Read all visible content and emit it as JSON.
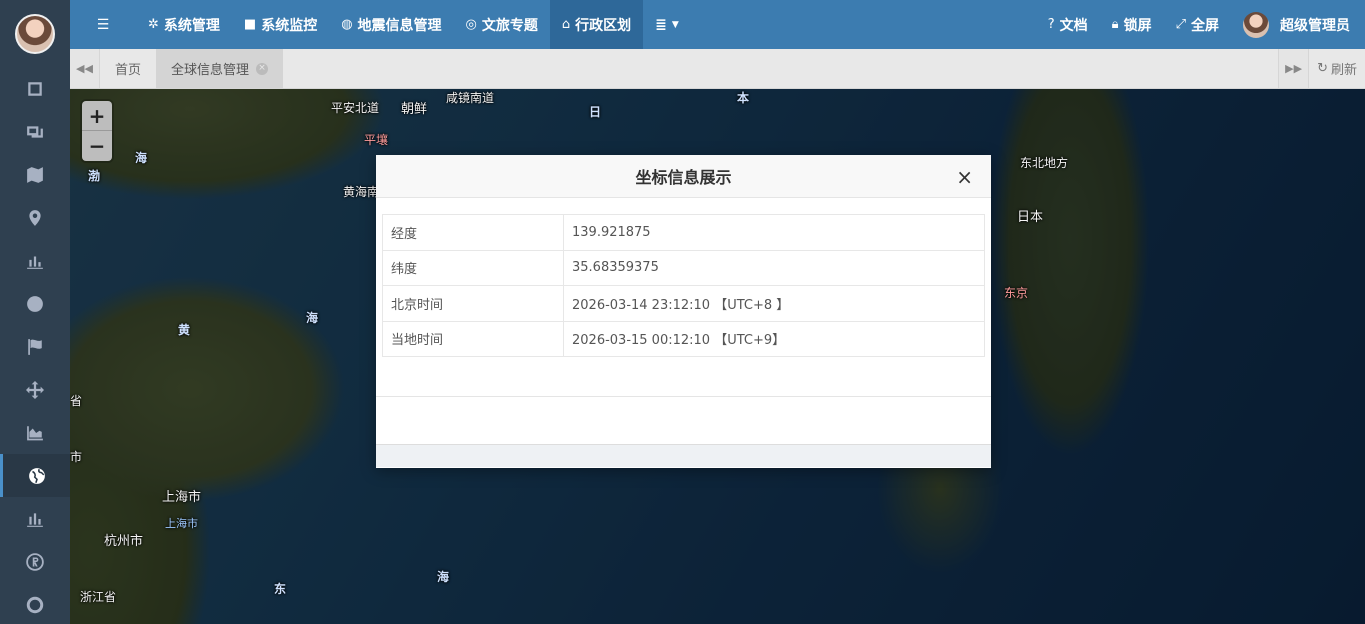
{
  "sidebar": {
    "items": [
      {
        "icon": "frame-icon"
      },
      {
        "icon": "frames-icon"
      },
      {
        "icon": "map-icon"
      },
      {
        "icon": "map-marker-icon"
      },
      {
        "icon": "bar-chart-icon"
      },
      {
        "icon": "globe-icon"
      },
      {
        "icon": "flag-icon"
      },
      {
        "icon": "move-arrows-icon"
      },
      {
        "icon": "area-chart-icon"
      },
      {
        "icon": "globe-icon",
        "active": true
      },
      {
        "icon": "bar-chart-icon"
      },
      {
        "icon": "registered-icon"
      },
      {
        "icon": "lifebuoy-icon"
      }
    ]
  },
  "navbar": {
    "items": [
      {
        "label": "系统管理",
        "icon": "gear-icon"
      },
      {
        "label": "系统监控",
        "icon": "video-camera-icon"
      },
      {
        "label": "地震信息管理",
        "icon": "lightbulb-icon"
      },
      {
        "label": "文旅专题",
        "icon": "lifebuoy-icon"
      },
      {
        "label": "行政区划",
        "icon": "bank-icon",
        "active": true
      }
    ],
    "right": {
      "docs": "文档",
      "lock": "锁屏",
      "fullscreen": "全屏",
      "user": "超级管理员"
    }
  },
  "tabs": {
    "items": [
      {
        "label": "首页"
      },
      {
        "label": "全球信息管理",
        "active": true
      }
    ],
    "refresh": "刷新"
  },
  "map": {
    "labels": [
      "平安北道",
      "朝鲜",
      "咸镜南道",
      "日",
      "本",
      "平壤",
      "黄海南",
      "海",
      "渤",
      "东北地方",
      "日本",
      "东京",
      "黄",
      "海",
      "省",
      "市",
      "上海市",
      "上海市",
      "杭州市",
      "浙江省",
      "东",
      "海"
    ],
    "zoom_in": "+",
    "zoom_out": "−"
  },
  "modal": {
    "title": "坐标信息展示",
    "close": "×",
    "rows": [
      {
        "key": "经度",
        "value": "139.921875"
      },
      {
        "key": "纬度",
        "value": "35.68359375"
      },
      {
        "key": "北京时间",
        "value": "2026-03-14 23:12:10 【UTC+8 】"
      },
      {
        "key": "当地时间",
        "value": "2026-03-15 00:12:10 【UTC+9】"
      }
    ]
  }
}
